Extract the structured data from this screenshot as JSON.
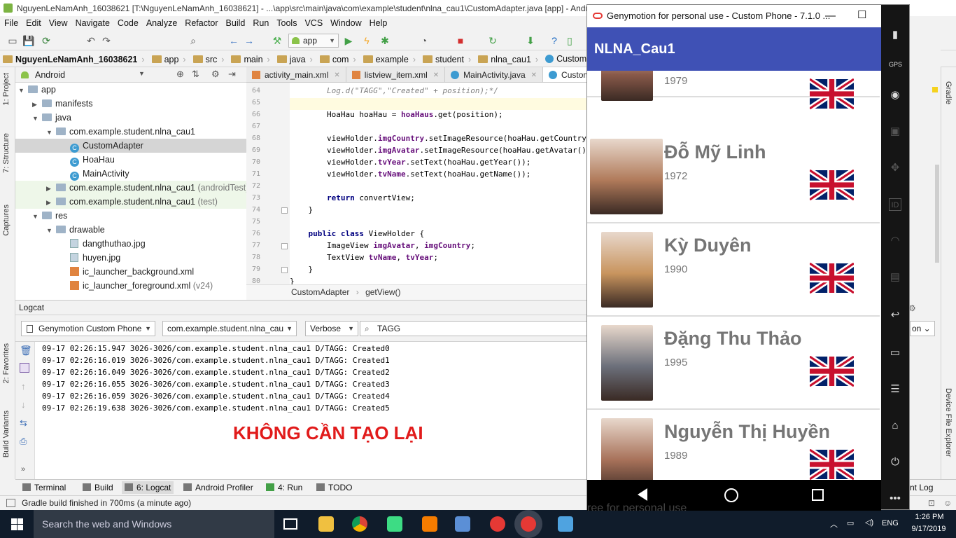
{
  "window_title": "NguyenLeNamAnh_16038621 [T:\\NguyenLeNamAnh_16038621] - ...\\app\\src\\main\\java\\com\\example\\student\\nlna_cau1\\CustomAdapter.java [app] - Android St",
  "menu": [
    "File",
    "Edit",
    "View",
    "Navigate",
    "Code",
    "Analyze",
    "Refactor",
    "Build",
    "Run",
    "Tools",
    "VCS",
    "Window",
    "Help"
  ],
  "toolbar": {
    "run_config": "app"
  },
  "breadcrumbs": [
    "NguyenLeNamAnh_16038621",
    "app",
    "src",
    "main",
    "java",
    "com",
    "example",
    "student",
    "nlna_cau1",
    "CustomAdapter"
  ],
  "project_panel": {
    "view": "Android"
  },
  "tree": [
    {
      "label": "app",
      "indent": 0,
      "icon": "folder",
      "arrow": "▼"
    },
    {
      "label": "manifests",
      "indent": 1,
      "icon": "folder",
      "arrow": "▶"
    },
    {
      "label": "java",
      "indent": 1,
      "icon": "folder",
      "arrow": "▼"
    },
    {
      "label": "com.example.student.nlna_cau1",
      "indent": 2,
      "icon": "folder",
      "arrow": "▼"
    },
    {
      "label": "CustomAdapter",
      "indent": 3,
      "icon": "class",
      "arrow": "",
      "selected": true
    },
    {
      "label": "HoaHau",
      "indent": 3,
      "icon": "class",
      "arrow": ""
    },
    {
      "label": "MainActivity",
      "indent": 3,
      "icon": "class",
      "arrow": ""
    },
    {
      "label": "com.example.student.nlna_cau1",
      "suffix": " (androidTest)",
      "indent": 2,
      "icon": "folder",
      "arrow": "▶",
      "green": true
    },
    {
      "label": "com.example.student.nlna_cau1",
      "suffix": " (test)",
      "indent": 2,
      "icon": "folder",
      "arrow": "▶",
      "green": true
    },
    {
      "label": "res",
      "indent": 1,
      "icon": "folder",
      "arrow": "▼"
    },
    {
      "label": "drawable",
      "indent": 2,
      "icon": "folder",
      "arrow": "▼"
    },
    {
      "label": "dangthuthao.jpg",
      "indent": 3,
      "icon": "image",
      "arrow": ""
    },
    {
      "label": "huyen.jpg",
      "indent": 3,
      "icon": "image",
      "arrow": ""
    },
    {
      "label": "ic_launcher_background.xml",
      "indent": 3,
      "icon": "xml",
      "arrow": ""
    },
    {
      "label": "ic_launcher_foreground.xml",
      "suffix": " (v24)",
      "indent": 3,
      "icon": "xml",
      "arrow": ""
    }
  ],
  "editor_tabs": [
    {
      "label": "activity_main.xml"
    },
    {
      "label": "listview_item.xml"
    },
    {
      "label": "MainActivity.java"
    },
    {
      "label": "CustomAdapter.java",
      "active": true
    }
  ],
  "code_lines": [
    {
      "n": "64",
      "text": "        Log.d(\"TAGG\",\"Created\" + position);*/",
      "style": "comment"
    },
    {
      "n": "65",
      "text": ""
    },
    {
      "n": "66",
      "text": "        HoaHau hoaHau = hoaHaus.get(position);"
    },
    {
      "n": "67",
      "text": ""
    },
    {
      "n": "68",
      "text": "        viewHolder.imgCountry.setImageResource(hoaHau.getCountry());"
    },
    {
      "n": "69",
      "text": "        viewHolder.imgAvatar.setImageResource(hoaHau.getAvatar());"
    },
    {
      "n": "70",
      "text": "        viewHolder.tvYear.setText(hoaHau.getYear());"
    },
    {
      "n": "71",
      "text": "        viewHolder.tvName.setText(hoaHau.getName());"
    },
    {
      "n": "72",
      "text": ""
    },
    {
      "n": "73",
      "text": "        return convertView;"
    },
    {
      "n": "74",
      "text": "    }"
    },
    {
      "n": "75",
      "text": ""
    },
    {
      "n": "76",
      "text": "    public class ViewHolder {"
    },
    {
      "n": "77",
      "text": "        ImageView imgAvatar, imgCountry;"
    },
    {
      "n": "78",
      "text": "        TextView tvName, tvYear;"
    },
    {
      "n": "79",
      "text": "    }"
    },
    {
      "n": "80",
      "text": "}"
    }
  ],
  "code_breadcrumb": [
    "CustomAdapter",
    "getView()"
  ],
  "logcat": {
    "title": "Logcat",
    "device": "Genymotion Custom Phone",
    "process": "com.example.student.nlna_cau1",
    "level": "Verbose",
    "filter": "TAGG",
    "lines": [
      "09-17 02:26:15.947 3026-3026/com.example.student.nlna_cau1 D/TAGG: Created0",
      "09-17 02:26:16.019 3026-3026/com.example.student.nlna_cau1 D/TAGG: Created1",
      "09-17 02:26:16.049 3026-3026/com.example.student.nlna_cau1 D/TAGG: Created2",
      "09-17 02:26:16.055 3026-3026/com.example.student.nlna_cau1 D/TAGG: Created3",
      "09-17 02:26:16.059 3026-3026/com.example.student.nlna_cau1 D/TAGG: Created4",
      "09-17 02:26:19.638 3026-3026/com.example.student.nlna_cau1 D/TAGG: Created5"
    ]
  },
  "overlay_text": "KHÔNG CẦN TẠO LẠI",
  "bottom_tabs": [
    "Terminal",
    "Build",
    "6: Logcat",
    "Android Profiler",
    "4: Run",
    "TODO"
  ],
  "bottom_right": "nt Log",
  "status": "Gradle build finished in 700ms (a minute ago)",
  "left_vtabs": [
    "1: Project",
    "7: Structure",
    "Captures",
    "2: Favorites",
    "Build Variants"
  ],
  "right_vtabs": [
    "Gradle",
    "Device File Explorer"
  ],
  "emulator": {
    "window_title": "Genymotion for personal use - Custom Phone - 7.1.0 ...",
    "app_title": "NLNA_Cau1",
    "items": [
      {
        "name": "",
        "year": "1979",
        "avatar_color": "#8a5a4a"
      },
      {
        "name": "Đỗ Mỹ Linh",
        "year": "1972",
        "avatar_color": "#b07a5a"
      },
      {
        "name": "Kỳ Duyên",
        "year": "1990",
        "avatar_color": "#c8945e"
      },
      {
        "name": "Đặng Thu Thảo",
        "year": "1995",
        "avatar_color": "#6b6f7a"
      },
      {
        "name": "Nguyễn Thị Huyền",
        "year": "1989",
        "avatar_color": "#a8725a"
      }
    ],
    "bottom_text": "ree for personal use"
  },
  "taskbar": {
    "search_placeholder": "Search the web and Windows",
    "language": "ENG",
    "time": "1:26 PM",
    "date": "9/17/2019"
  }
}
